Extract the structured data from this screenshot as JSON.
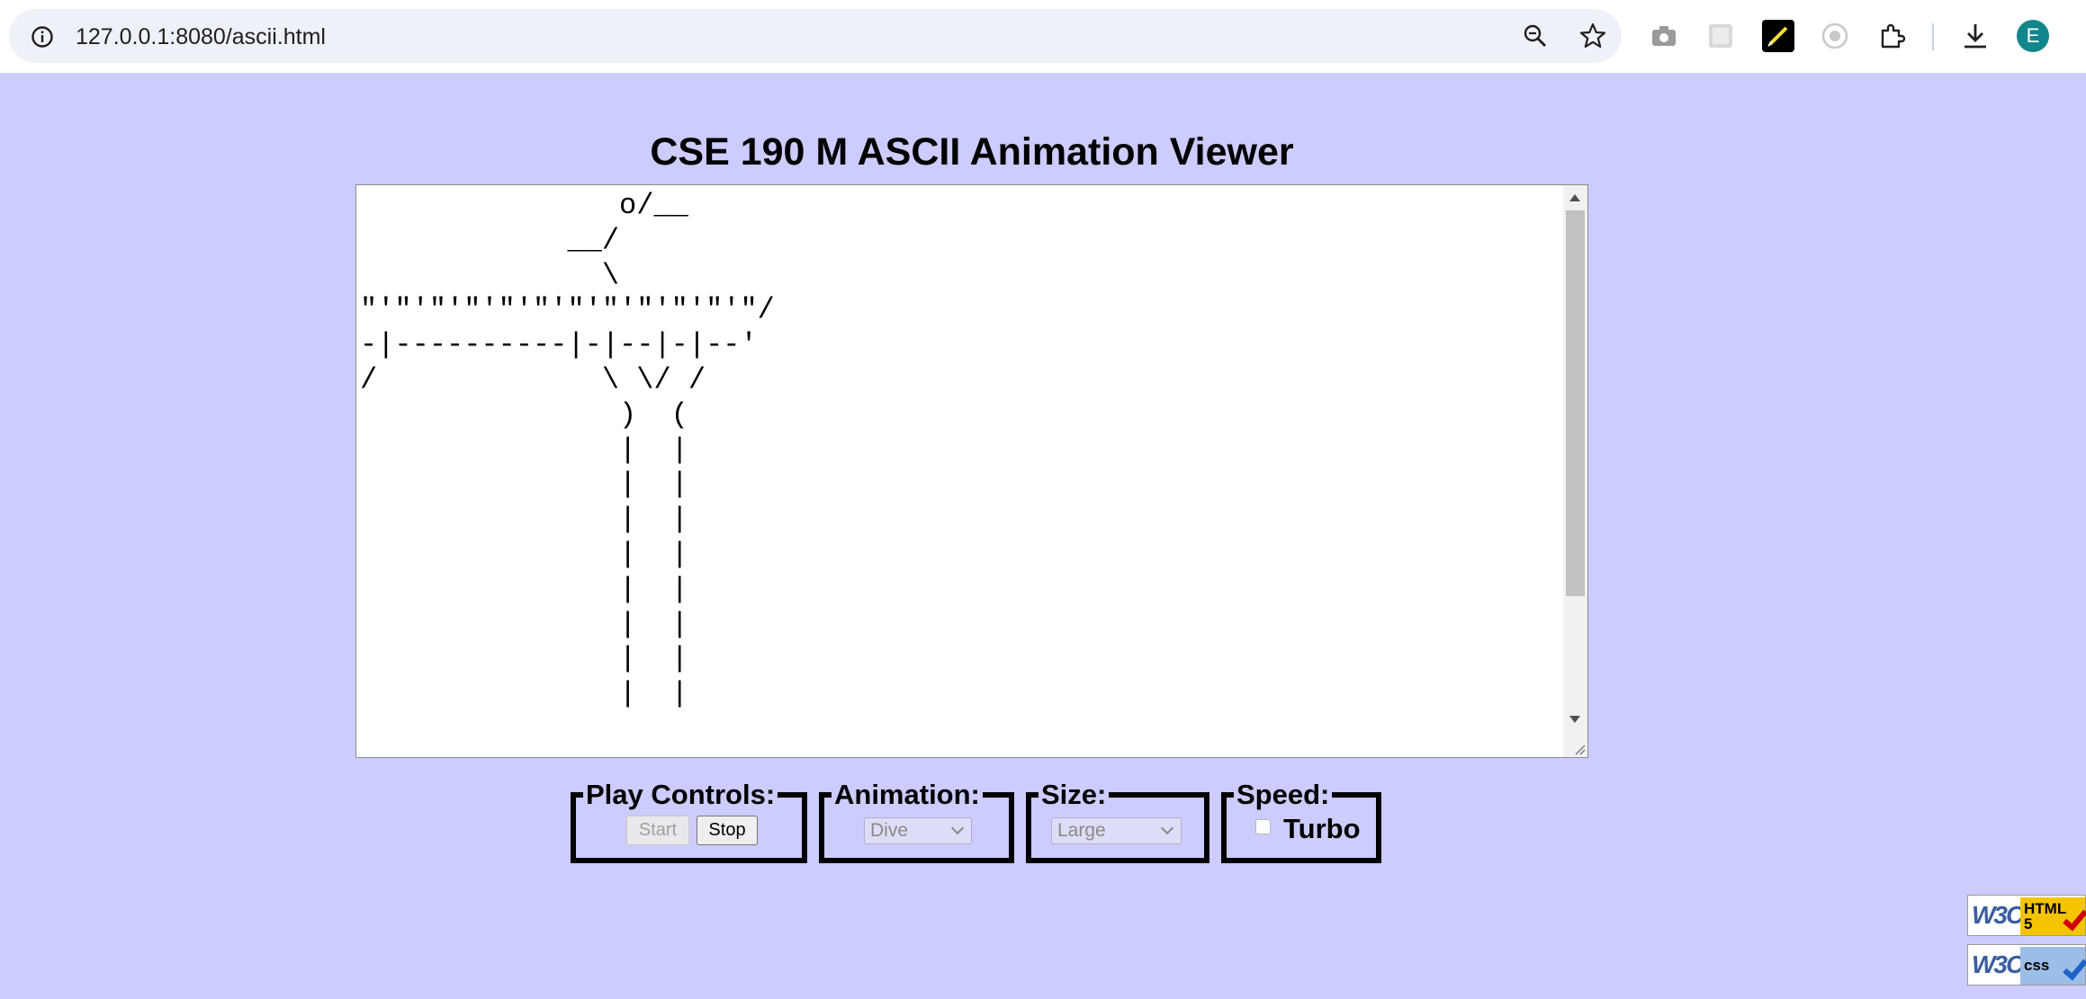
{
  "browser": {
    "url": "127.0.0.1:8080/ascii.html",
    "profile_initial": "E",
    "toolbar_icons": [
      "zoom-icon",
      "bookmark-star-icon",
      "camera-icon",
      "extension-grid-icon",
      "pen-extension-icon",
      "record-icon",
      "puzzle-extensions-icon",
      "download-icon"
    ]
  },
  "page": {
    "title": "CSE 190 M ASCII Animation Viewer",
    "ascii_frame": "               o/__\n            __/\n              \\\n\"'\"'\"'\"'\"'\"'\"'\"'\"'\"'\"'\"/\n-|----------|-|--|-|--'\n/             \\ \\/ /\n               )  (\n               |  |\n               |  |\n               |  |\n               |  |\n               |  |\n               |  |\n               |  |\n               |  |"
  },
  "controls": {
    "play": {
      "legend": "Play Controls:",
      "start_label": "Start",
      "stop_label": "Stop"
    },
    "animation": {
      "legend": "Animation:",
      "selected": "Dive"
    },
    "size": {
      "legend": "Size:",
      "selected": "Large"
    },
    "speed": {
      "legend": "Speed:",
      "turbo_label": "Turbo",
      "turbo_checked": false
    }
  },
  "badges": {
    "html": {
      "text": "HTML\n5"
    },
    "css": {
      "text": "css"
    }
  },
  "colors": {
    "page_background": "#ccccff",
    "avatar": "#12868d"
  }
}
